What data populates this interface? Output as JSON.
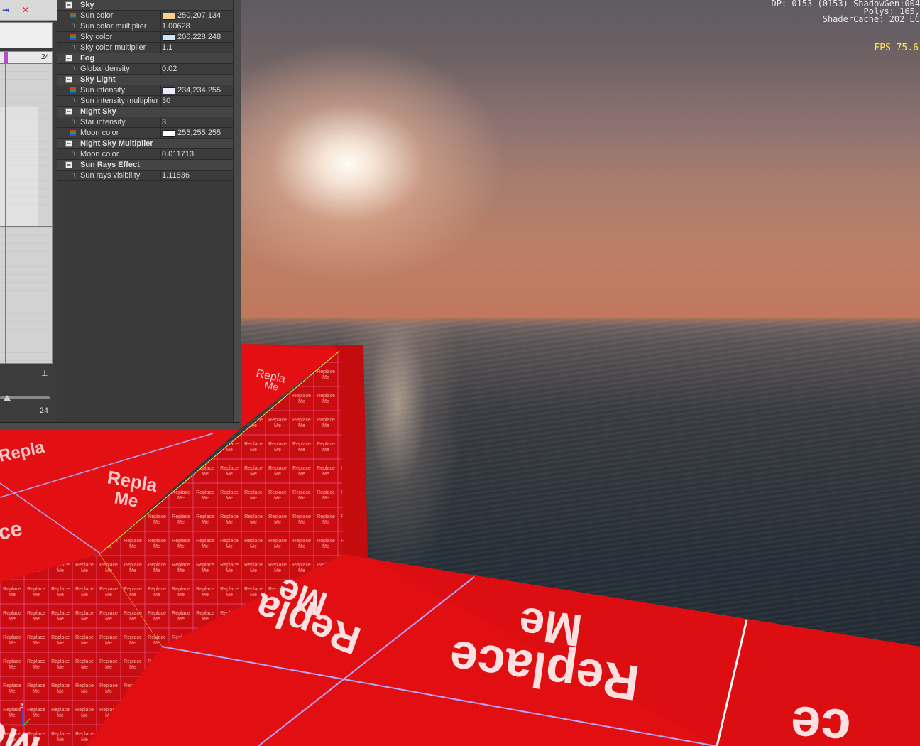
{
  "hud": {
    "stats_lines": "DP: 0153 (0153) ShadowGen:004\nPolys: 165,\nShaderCache: 202 LC",
    "fps": "FPS 75.6"
  },
  "timeline": {
    "ruler_end_frame": "24",
    "current_frame": "24",
    "toolbar_icons": [
      "next-key-icon",
      "delete-key-icon"
    ]
  },
  "properties": {
    "groups": [
      {
        "label": "Sky",
        "props": [
          {
            "name": "Sun color",
            "type": "color",
            "value": "250,207,134",
            "swatch": "#facf86"
          },
          {
            "name": "Sun color multiplier",
            "type": "number",
            "value": "1.00628"
          },
          {
            "name": "Sky color",
            "type": "color",
            "value": "206,228,248",
            "swatch": "#cee4f8"
          },
          {
            "name": "Sky color multiplier",
            "type": "number",
            "value": "1.1"
          }
        ]
      },
      {
        "label": "Fog",
        "props": [
          {
            "name": "Global density",
            "type": "number",
            "value": "0.02"
          }
        ]
      },
      {
        "label": "Sky Light",
        "props": [
          {
            "name": "Sun intensity",
            "type": "color",
            "value": "234,234,255",
            "swatch": "#eaeaff"
          },
          {
            "name": "Sun intensity multiplier",
            "type": "number",
            "value": "30"
          }
        ]
      },
      {
        "label": "Night Sky",
        "props": [
          {
            "name": "Star intensity",
            "type": "number",
            "value": "3"
          },
          {
            "name": "Moon color",
            "type": "color",
            "value": "255,255,255",
            "swatch": "#ffffff"
          }
        ]
      },
      {
        "label": "Night Sky Multiplier",
        "props": [
          {
            "name": "Moon color",
            "type": "number",
            "value": "0.011713"
          }
        ]
      },
      {
        "label": "Sun Rays Effect",
        "props": [
          {
            "name": "Sun rays visibility",
            "type": "number",
            "value": "1.11836"
          }
        ]
      }
    ]
  },
  "scene": {
    "texture_text_line1": "Replace",
    "texture_text_line2": "Me",
    "partial_texts": [
      "Repla",
      "ce",
      "Me"
    ],
    "gizmo_axis_label": "z",
    "colors": {
      "block_red": "#e10f12",
      "block_red_dark": "#b50a0c",
      "grid_line": "#b9a7ff"
    }
  }
}
